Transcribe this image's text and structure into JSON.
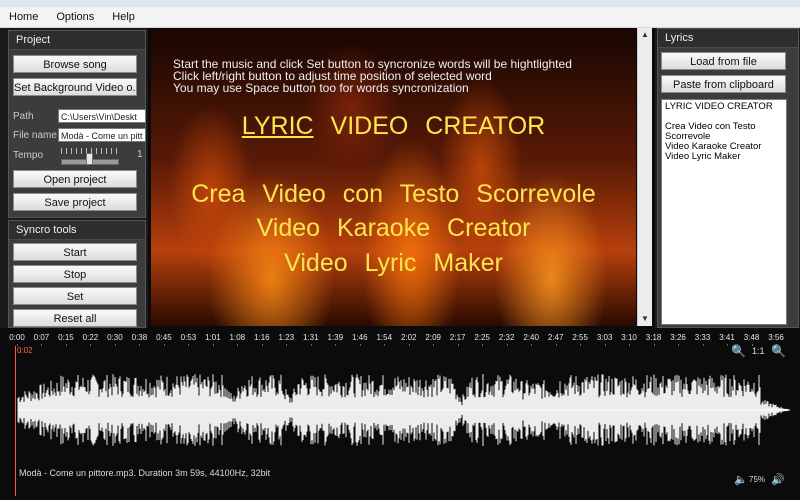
{
  "menu": {
    "home": "Home",
    "options": "Options",
    "help": "Help"
  },
  "project": {
    "title": "Project",
    "browse_song": "Browse song",
    "set_background": "Set Background Video o...",
    "path_label": "Path",
    "path_value": "C:\\Users\\Vin\\Deskt",
    "filename_label": "File name",
    "filename_value": "Modà - Come un pitt",
    "tempo_label": "Tempo",
    "tempo_value": "1",
    "tempo_level": 0.5,
    "open_project": "Open project",
    "save_project": "Save project"
  },
  "syncro": {
    "title": "Syncro tools",
    "start": "Start",
    "stop": "Stop",
    "set": "Set",
    "reset_all": "Reset all"
  },
  "video": {
    "instructions": [
      "Start the music and click Set button to syncronize words will be hightlighted",
      "Click left/right button to adjust time position of selected word",
      "You may use Space button too for words syncronization"
    ],
    "title_words": [
      "LYRIC",
      "VIDEO",
      "CREATOR"
    ],
    "lines": [
      "Crea  Video  con  Testo  Scorrevole",
      "Video  Karaoke  Creator",
      "Video  Lyric  Maker"
    ]
  },
  "lyrics": {
    "title": "Lyrics",
    "load_from_file": "Load from file",
    "paste_from_clipboard": "Paste from clipboard",
    "text_lines": [
      "LYRIC VIDEO CREATOR",
      "",
      "Crea Video con Testo",
      "Scorrevole",
      "Video Karaoke Creator",
      "Video Lyric Maker"
    ]
  },
  "timeline": {
    "ticks": [
      "0:00",
      "0:07",
      "0:15",
      "0:22",
      "0:30",
      "0:38",
      "0:45",
      "0:53",
      "1:01",
      "1:08",
      "1:16",
      "1:23",
      "1:31",
      "1:39",
      "1:46",
      "1:54",
      "2:02",
      "2:09",
      "2:17",
      "2:25",
      "2:32",
      "2:40",
      "2:47",
      "2:55",
      "3:03",
      "3:10",
      "3:18",
      "3:26",
      "3:33",
      "3:41",
      "3:48",
      "3:56"
    ]
  },
  "waveform": {
    "cursor_time": "0:02",
    "zoom_in_icon": "zoom-in-icon",
    "zoom_value": "1:1",
    "zoom_out_icon": "zoom-out-icon",
    "file_info": "Modà - Come un pittore.mp3.  Duration 3m 59s, 44100Hz, 32bit",
    "volume_icon": "speaker-icon",
    "volume_value": "75%"
  },
  "colors": {
    "lyric_text": "#ffe44d",
    "playhead": "#ff5a3a",
    "waveform": "#ececec"
  }
}
